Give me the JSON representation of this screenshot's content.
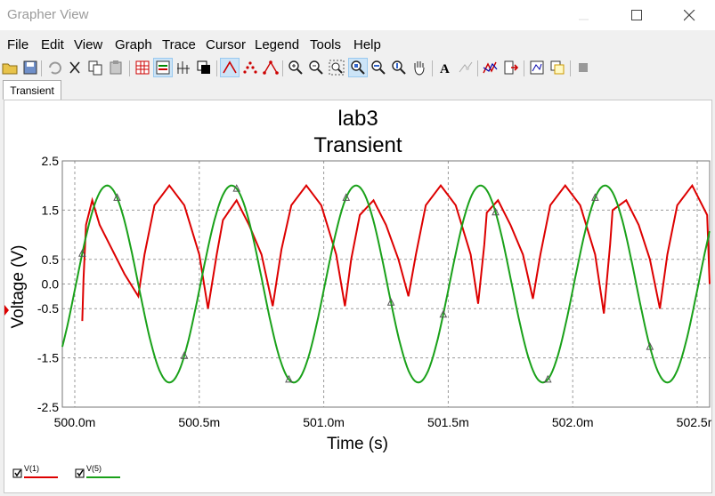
{
  "window": {
    "title": "Grapher View"
  },
  "menu": [
    "File",
    "Edit",
    "View",
    "Graph",
    "Trace",
    "Cursor",
    "Legend",
    "Tools",
    "Help"
  ],
  "toolbar": {
    "icons": [
      "open-icon",
      "save-icon",
      "undo-icon",
      "cut-icon",
      "copy-icon",
      "paste-icon",
      "grid-icon",
      "toggle-legend-icon",
      "cursors-icon",
      "reverse-colors-icon",
      "show-lines-icon",
      "show-points-icon",
      "lines-points-icon",
      "zoom-in-icon",
      "zoom-out-icon",
      "zoom-full-icon",
      "zoom-area-icon",
      "zoom-x-icon",
      "zoom-y-icon",
      "pan-icon",
      "text-icon",
      "label-icon",
      "trace-icon",
      "export-icon",
      "copy-graph-icon",
      "overlay-icon",
      "stop-icon"
    ]
  },
  "tabs": [
    {
      "label": "Transient"
    }
  ],
  "chart_data": {
    "type": "line",
    "title": "lab3",
    "subtitle": "Transient",
    "xlabel": "Time (s)",
    "ylabel": "Voltage (V)",
    "xlim": [
      0.49995,
      0.50255
    ],
    "ylim": [
      -2.5,
      2.5
    ],
    "xticks": [
      0.5,
      0.5005,
      0.501,
      0.5015,
      0.502,
      0.5025
    ],
    "xticklabels": [
      "500.0m",
      "500.5m",
      "501.0m",
      "501.5m",
      "502.0m",
      "502.5m"
    ],
    "yticks": [
      2.5,
      1.5,
      0.5,
      0.0,
      -0.5,
      -1.5,
      -2.5
    ],
    "yticklabels": [
      "2.5",
      "1.5",
      "0.5",
      "0.0",
      "-0.5",
      "-1.5",
      "-2.5"
    ],
    "grid": true,
    "series": [
      {
        "name": "V(1)",
        "color": "#dd0000",
        "points": [
          [
            0.50003,
            -0.75
          ],
          [
            0.500035,
            0.1
          ],
          [
            0.500045,
            1.2
          ],
          [
            0.50007,
            1.7
          ],
          [
            0.5001,
            1.2
          ],
          [
            0.50015,
            0.7
          ],
          [
            0.5002,
            0.2
          ],
          [
            0.500255,
            -0.25
          ],
          [
            0.50028,
            0.6
          ],
          [
            0.50032,
            1.6
          ],
          [
            0.50038,
            2.0
          ],
          [
            0.50044,
            1.6
          ],
          [
            0.5005,
            0.6
          ],
          [
            0.500535,
            -0.5
          ],
          [
            0.50057,
            0.6
          ],
          [
            0.500595,
            1.3
          ],
          [
            0.50065,
            1.7
          ],
          [
            0.5007,
            1.2
          ],
          [
            0.50075,
            0.6
          ],
          [
            0.500795,
            -0.45
          ],
          [
            0.50083,
            0.7
          ],
          [
            0.50087,
            1.6
          ],
          [
            0.50093,
            2.0
          ],
          [
            0.50099,
            1.6
          ],
          [
            0.50105,
            0.6
          ],
          [
            0.501085,
            -0.45
          ],
          [
            0.50111,
            0.5
          ],
          [
            0.501145,
            1.4
          ],
          [
            0.5012,
            1.7
          ],
          [
            0.50125,
            1.2
          ],
          [
            0.5013,
            0.5
          ],
          [
            0.50134,
            -0.25
          ],
          [
            0.50137,
            0.6
          ],
          [
            0.50141,
            1.6
          ],
          [
            0.50147,
            2.0
          ],
          [
            0.50153,
            1.6
          ],
          [
            0.50159,
            0.6
          ],
          [
            0.50162,
            -0.4
          ],
          [
            0.501645,
            0.8
          ],
          [
            0.501655,
            1.45
          ],
          [
            0.5017,
            1.7
          ],
          [
            0.50175,
            1.2
          ],
          [
            0.5018,
            0.6
          ],
          [
            0.50184,
            -0.3
          ],
          [
            0.50187,
            0.6
          ],
          [
            0.50191,
            1.6
          ],
          [
            0.50197,
            2.0
          ],
          [
            0.50203,
            1.6
          ],
          [
            0.50209,
            0.6
          ],
          [
            0.502125,
            -0.6
          ],
          [
            0.50215,
            0.8
          ],
          [
            0.50216,
            1.5
          ],
          [
            0.502215,
            1.7
          ],
          [
            0.502265,
            1.2
          ],
          [
            0.50231,
            0.5
          ],
          [
            0.50235,
            -0.5
          ],
          [
            0.50238,
            0.6
          ],
          [
            0.50242,
            1.6
          ],
          [
            0.50248,
            2.0
          ],
          [
            0.50254,
            1.4
          ],
          [
            0.50255,
            0.0
          ]
        ]
      },
      {
        "name": "V(5)",
        "color": "#1aa11a",
        "sine": {
          "amplitude": 2.0,
          "period_s": 0.0005,
          "peak_at_s": 0.50013
        },
        "markers": [
          0.50003,
          0.50017,
          0.50044,
          0.50065,
          0.50086,
          0.50109,
          0.50127,
          0.50148,
          0.50169,
          0.5019,
          0.50209,
          0.50231
        ]
      }
    ]
  },
  "legend": [
    {
      "label": "V(1)",
      "color": "#dd0000",
      "checked": true
    },
    {
      "label": "V(5)",
      "color": "#1aa11a",
      "checked": true
    }
  ]
}
